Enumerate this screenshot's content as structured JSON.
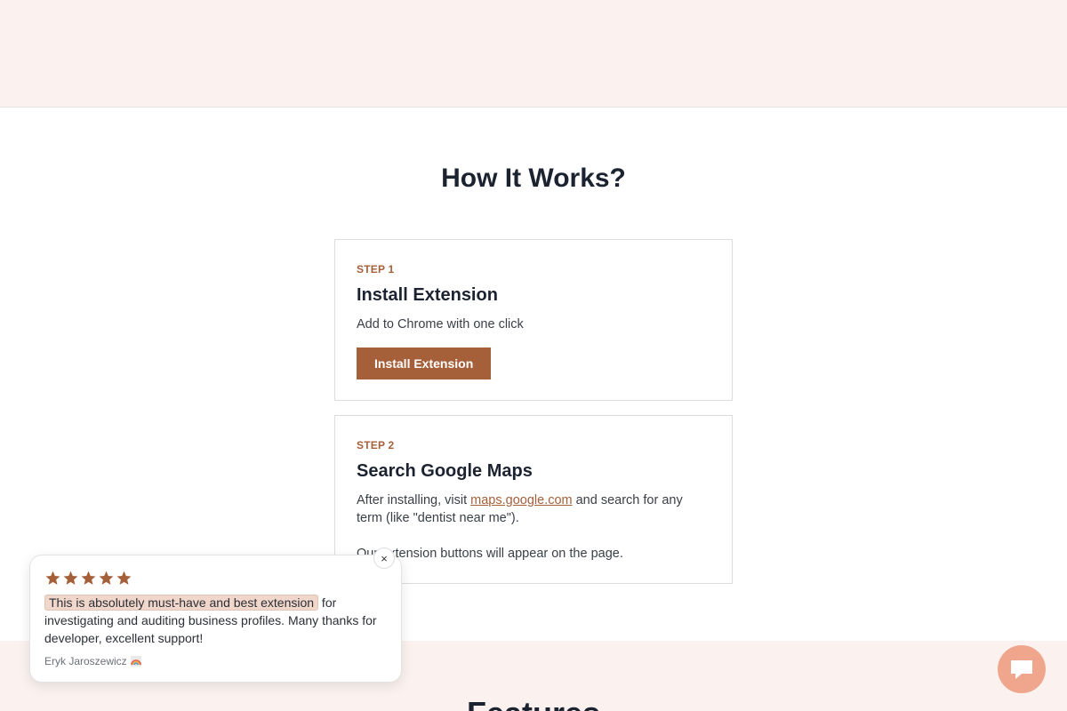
{
  "how_it_works": {
    "title": "How It Works?",
    "steps": [
      {
        "label": "STEP 1",
        "heading": "Install Extension",
        "text": "Add to Chrome with one click",
        "button_label": "Install Extension"
      },
      {
        "label": "STEP 2",
        "heading": "Search Google Maps",
        "text_before_link": "After installing, visit ",
        "link_text": "maps.google.com",
        "text_after_link": " and search for any term (like \"dentist near me\").",
        "text_second": "Our extension buttons will appear on the page."
      }
    ]
  },
  "features": {
    "title": "Features"
  },
  "review": {
    "stars": 5,
    "highlight": "This is absolutely must-have and best extension",
    "text": " for investigating and auditing business profiles. Many thanks for developer, excellent support!",
    "reviewer": "Eryk Jaroszewicz",
    "close_label": "×"
  },
  "colors": {
    "accent": "#a5603a",
    "band_bg": "#fbf2ef",
    "chat_button": "#f0a68c",
    "highlight_bg": "#f1d7cb"
  },
  "icons": {
    "star": "star-icon",
    "close": "close-icon",
    "chat": "chat-icon",
    "rainbow": "rainbow-icon"
  }
}
